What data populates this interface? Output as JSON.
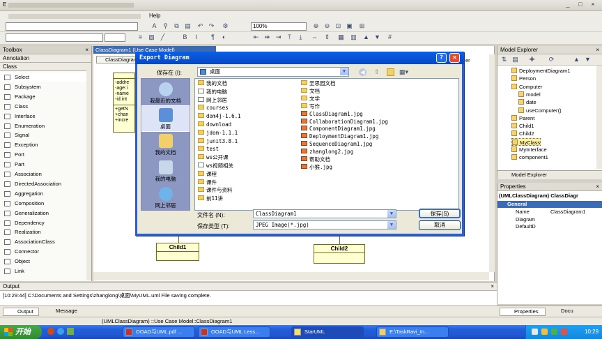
{
  "window": {
    "title": "E",
    "controls": [
      "_",
      "□",
      "×"
    ]
  },
  "menu": {
    "items": [
      "Help"
    ]
  },
  "toolbar": {
    "zoom": "100%"
  },
  "toolbox": {
    "header": "Toolbox",
    "group_annotation": "Annotation",
    "group_class": "Class",
    "items": [
      "Select",
      "Subsystem",
      "Package",
      "Class",
      "Interface",
      "Enumeration",
      "Signal",
      "Exception",
      "Port",
      "Part",
      "Association",
      "DirectedAssociation",
      "Aggregation",
      "Composition",
      "Generalization",
      "Dependency",
      "Realization",
      "AssociationClass",
      "Connector",
      "Object",
      "Link"
    ]
  },
  "diagram": {
    "tab": "ClassDiagram1 (Use Case Model)",
    "inner_tab": "ClassDiagram1",
    "class_attrs": [
      "-addre",
      "-age: i",
      "-name",
      "-id:int"
    ],
    "class_ops": [
      "+getN",
      "+chan",
      "+incre"
    ],
    "child1": "Child1",
    "child2": "Child2",
    "right_clip": "er"
  },
  "dialog": {
    "title": "Export Diagram",
    "save_in_label": "保存在 (I):",
    "save_in_value": "桌面",
    "places": [
      "我最近的文档",
      "桌面",
      "我的文档",
      "我的电脑",
      "网上邻居"
    ],
    "files_col1": [
      "我的文档",
      "我的电脑",
      "网上邻居",
      "courses",
      "dom4j-1.6.1",
      "download",
      "jdom-1.1.1",
      "junit3.8.1",
      "test",
      "ws公开课",
      "ws视频相关",
      "课程",
      "课件",
      "课件与资料",
      "前11讲"
    ],
    "files_col2": [
      "圣思园文档",
      "文档",
      "文学",
      "写作",
      "ClassDiagram1.jpg",
      "CollaborationDiagram1.jpg",
      "ComponentDiagram1.jpg",
      "DeploymentDiagram1.jpg",
      "SequenceDiagram1.jpg",
      "zhanglong2.jpg",
      "帮助文档",
      "小猴.jpg"
    ],
    "filename_label": "文件名 (N):",
    "filename_value": "ClassDiagram1",
    "filetype_label": "保存类型 (T):",
    "filetype_value": "JPEG Image(*.jpg)",
    "save_button": "保存(S)",
    "cancel_button": "取消",
    "help_btn": "?",
    "close_btn": "×"
  },
  "explorer": {
    "header": "Model Explorer",
    "nodes": [
      "DeploymentDiagram1",
      "Person",
      "Computer",
      "model",
      "date",
      "useComputer()",
      "Parent",
      "Child1",
      "Child2",
      "MyClass",
      "MyInterface",
      "component1"
    ],
    "tab_explorer": "Model Explorer"
  },
  "properties": {
    "header": "Properties",
    "title": "(UMLClassDiagram) ClassDiagr",
    "group": "General",
    "rows": [
      {
        "name": "Name",
        "value": "ClassDiagram1"
      },
      {
        "name": "Diagram",
        "value": ""
      },
      {
        "name": "DefaultD",
        "value": ""
      }
    ],
    "tab_properties": "Properties",
    "tab_docu": "Docu"
  },
  "output": {
    "header": "Output",
    "line": "[10:29:44]  C:\\Documents and Settings\\zhanglong\\桌面\\MyUML.uml File saving complete.",
    "tab_output": "Output",
    "tab_message": "Message"
  },
  "status": {
    "text": "(UMLClassDiagram) ::Use Case Model::ClassDiagram1"
  },
  "taskbar": {
    "start": "开始",
    "tasks": [
      "OOAD与UML.pdf ...",
      "OOAD与UML Less...",
      "StarUML",
      "E:\\TaskRavi_In..."
    ],
    "clock": "10:29"
  }
}
